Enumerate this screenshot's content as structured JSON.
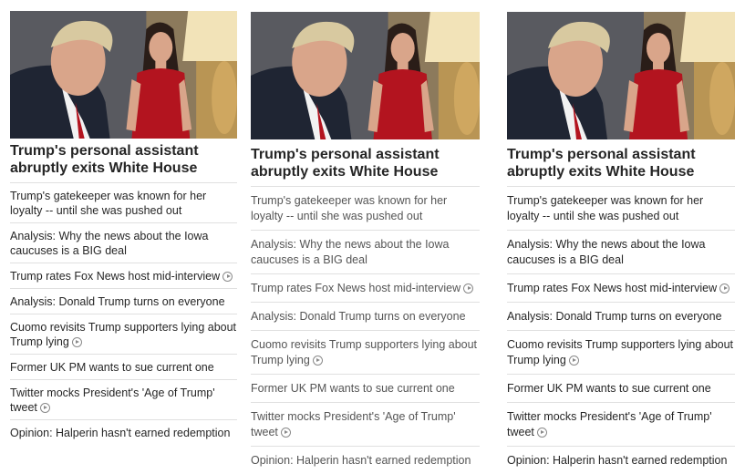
{
  "photo": {
    "alt_subject": "news-photo",
    "colors": {
      "suit": "#1f2533",
      "dress": "#b3141f",
      "skin": "#d9a58a",
      "hair_man": "#d8c9a0",
      "hair_woman": "#2a1d18",
      "lamp": "#f2e3b8"
    }
  },
  "columns": [
    {
      "headline": "Trump's personal assistant abruptly exits White House",
      "items": [
        {
          "text": "Trump's gatekeeper was known for her loyalty -- until she was pushed out",
          "video": false
        },
        {
          "text": "Analysis: Why the news about the Iowa caucuses is a BIG deal",
          "video": false
        },
        {
          "text": "Trump rates Fox News host mid-interview",
          "video": true
        },
        {
          "text": "Analysis: Donald Trump turns on everyone",
          "video": false
        },
        {
          "text": "Cuomo revisits Trump supporters lying about Trump lying",
          "video": true
        },
        {
          "text": "Former UK PM wants to sue current one",
          "video": false
        },
        {
          "text": "Twitter mocks President's 'Age of Trump' tweet",
          "video": true
        },
        {
          "text": "Opinion: Halperin hasn't earned redemption",
          "video": false
        }
      ]
    },
    {
      "headline": "Trump's personal assistant abruptly exits White House",
      "items": [
        {
          "text": "Trump's gatekeeper was known for her loyalty -- until she was pushed out",
          "video": false
        },
        {
          "text": "Analysis: Why the news about the Iowa caucuses is a BIG deal",
          "video": false
        },
        {
          "text": "Trump rates Fox News host mid-interview",
          "video": true
        },
        {
          "text": "Analysis: Donald Trump turns on everyone",
          "video": false
        },
        {
          "text": "Cuomo revisits Trump supporters lying about Trump lying",
          "video": true
        },
        {
          "text": "Former UK PM wants to sue current one",
          "video": false
        },
        {
          "text": "Twitter mocks President's 'Age of Trump' tweet",
          "video": true
        },
        {
          "text": "Opinion: Halperin hasn't earned redemption",
          "video": false
        }
      ]
    },
    {
      "headline": "Trump's personal assistant abruptly exits White House",
      "items": [
        {
          "text": "Trump's gatekeeper was known for her loyalty -- until she was pushed out",
          "video": false
        },
        {
          "text": "Analysis: Why the news about the Iowa caucuses is a BIG deal",
          "video": false
        },
        {
          "text": "Trump rates Fox News host mid-interview",
          "video": true
        },
        {
          "text": "Analysis: Donald Trump turns on everyone",
          "video": false
        },
        {
          "text": "Cuomo revisits Trump supporters lying about Trump lying",
          "video": true
        },
        {
          "text": "Former UK PM wants to sue current one",
          "video": false
        },
        {
          "text": "Twitter mocks President's 'Age of Trump' tweet",
          "video": true
        },
        {
          "text": "Opinion: Halperin hasn't earned redemption",
          "video": false
        }
      ]
    }
  ]
}
